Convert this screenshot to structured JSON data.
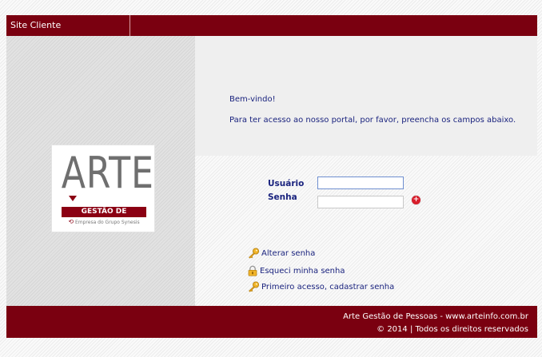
{
  "header": {
    "tab_label": "Site Cliente"
  },
  "logo": {
    "word": "ARTE",
    "bar_text": "GESTÃO DE PESSOAS",
    "subtitle": "Empresa do Grupo Synesis"
  },
  "welcome": {
    "greeting": "Bem-vindo!",
    "instruction": "Para ter acesso ao nosso portal, por favor, preencha os campos abaixo."
  },
  "login": {
    "username_label": "Usuário",
    "password_label": "Senha",
    "username_value": "",
    "password_value": "",
    "submit_icon": "plus-circle-icon"
  },
  "links": [
    {
      "label": "Alterar senha",
      "icon": "key-icon"
    },
    {
      "label": "Esqueci minha senha",
      "icon": "lock-icon"
    },
    {
      "label": "Primeiro acesso, cadastrar senha",
      "icon": "key-icon"
    }
  ],
  "footer": {
    "line1": "Arte Gestão de Pessoas - www.arteinfo.com.br",
    "line2": "© 2014 | Todos os direitos reservados"
  },
  "colors": {
    "brand": "#7a0010",
    "text": "#1a237e",
    "accent_red": "#d81e2c"
  }
}
